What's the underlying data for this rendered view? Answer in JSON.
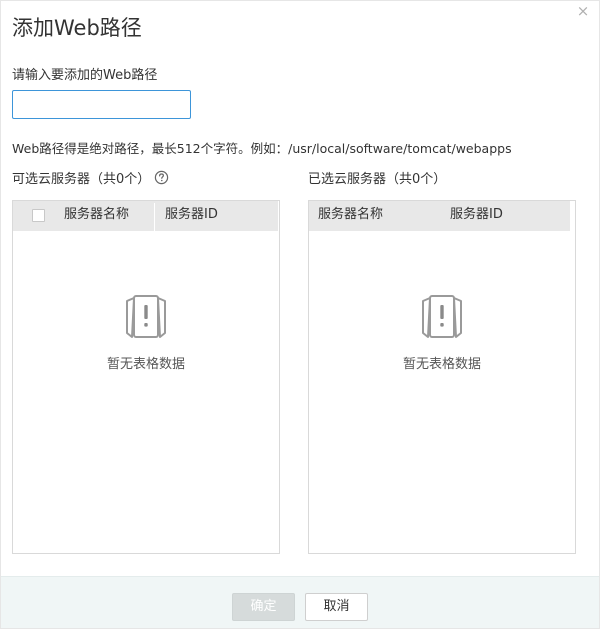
{
  "dialog": {
    "title": "添加Web路径",
    "close_label": "×",
    "field_label": "请输入要添加的Web路径",
    "input_value": "",
    "input_placeholder": "",
    "hint": "Web路径得是绝对路径，最长512个字符。例如：/usr/local/software/tomcat/webapps"
  },
  "available": {
    "title": "可选云服务器（共0个）",
    "columns": [
      "服务器名称",
      "服务器ID"
    ],
    "rows": [],
    "empty_text": "暂无表格数据"
  },
  "selected": {
    "title": "已选云服务器（共0个）",
    "columns": [
      "服务器名称",
      "服务器ID"
    ],
    "rows": [],
    "empty_text": "暂无表格数据"
  },
  "footer": {
    "ok_label": "确定",
    "cancel_label": "取消"
  },
  "icons": {
    "help": "help-circle-icon",
    "empty": "empty-document-icon",
    "close": "close-icon"
  },
  "colors": {
    "input_focus_border": "#3d95d9",
    "header_bg": "#e8e8e8",
    "footer_bg": "#f0f6f6",
    "ok_disabled_bg": "#d6dbdb"
  }
}
